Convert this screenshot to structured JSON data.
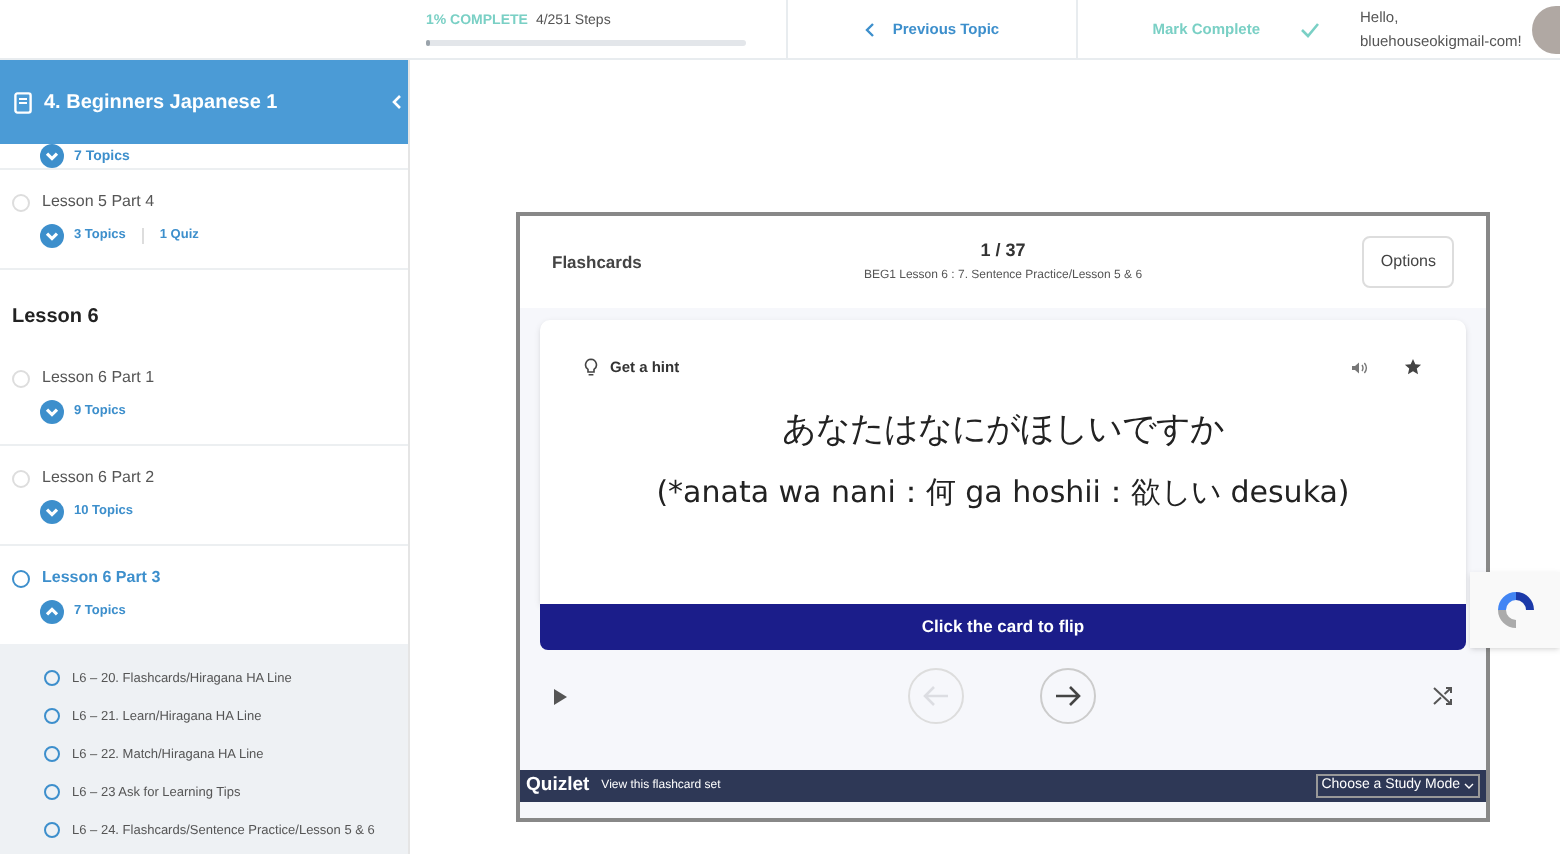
{
  "topbar": {
    "progress_label": "1% COMPLETE",
    "steps": "4/251 Steps",
    "level": 0.01,
    "previous": "Previous Topic",
    "mark_complete": "Mark Complete",
    "greeting": "Hello,",
    "user": "bluehouseokigmail-com!"
  },
  "sidebar": {
    "course": "4. Beginners Japanese 1",
    "items": [
      {
        "kind": "counts",
        "topics": "7 Topics",
        "expanded": false
      },
      {
        "kind": "lesson",
        "title": "Lesson 5 Part 4",
        "topics": "3 Topics",
        "quiz": "1 Quiz",
        "expanded": false,
        "selected": false
      },
      {
        "kind": "heading",
        "title": "Lesson 6"
      },
      {
        "kind": "lesson",
        "title": "Lesson 6 Part 1",
        "topics": "9 Topics",
        "expanded": false,
        "selected": false
      },
      {
        "kind": "lesson",
        "title": "Lesson 6 Part 2",
        "topics": "10 Topics",
        "expanded": false,
        "selected": false
      },
      {
        "kind": "lesson",
        "title": "Lesson 6 Part 3",
        "topics": "7 Topics",
        "expanded": true,
        "selected": true,
        "children": [
          {
            "title": "L6 – 20. Flashcards/Hiragana HA Line"
          },
          {
            "title": "L6 – 21. Learn/Hiragana HA Line"
          },
          {
            "title": "L6 – 22. Match/Hiragana HA Line"
          },
          {
            "title": "L6 – 23 Ask for Learning Tips"
          },
          {
            "title": "L6 – 24. Flashcards/Sentence Practice/Lesson 5 & 6"
          }
        ]
      }
    ]
  },
  "flashcards": {
    "title": "Flashcards",
    "counter": "1 / 37",
    "set_name": "BEG1 Lesson 6 : 7. Sentence Practice/Lesson 5 & 6",
    "options": "Options",
    "hint": "Get a hint",
    "front": "あなたはなにがほしいですか",
    "reading": "(*anata wa nani：何 ga hoshii：欲しい desuka)",
    "flip": "Click the card to flip",
    "previous_disabled": true,
    "next_disabled": false,
    "brand": "Quizlet",
    "view_set": "View this flashcard set",
    "study_mode": "Choose a Study Mode"
  }
}
